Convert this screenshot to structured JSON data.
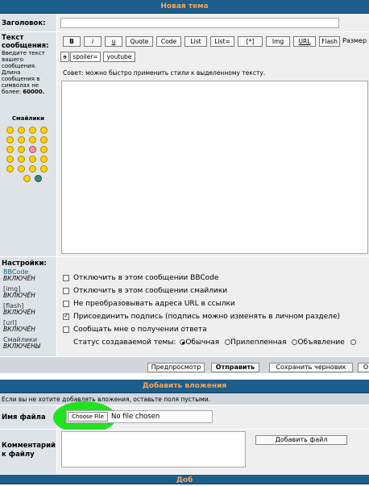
{
  "header": {
    "title": "Новая тема"
  },
  "subject": {
    "label": "Заголовок:",
    "value": ""
  },
  "message": {
    "label": "Текст сообщения:",
    "hint_lines": [
      "Введите текст",
      "вашего",
      "сообщения.",
      "Длина",
      "сообщения в",
      "символах не",
      "более:"
    ],
    "max_length": "60000.",
    "tip": "Совет: можно быстро применить стили к выделенному тексту.",
    "size_label": "Размер",
    "toolbar": [
      "B",
      "i",
      "u",
      "Quote",
      "Code",
      "List",
      "List=",
      "[*]",
      "Img",
      "URL",
      "Flash",
      "s",
      "spoiler=",
      "youtube"
    ]
  },
  "smilies": {
    "title": "Смайлики"
  },
  "settings": {
    "label": "Настройки:",
    "items": [
      {
        "name": "BBCode",
        "state": "ВКЛЮЧЁН"
      },
      {
        "name": "[img]",
        "state": "ВКЛЮЧЁН"
      },
      {
        "name": "[flash]",
        "state": "ВКЛЮЧЁН"
      },
      {
        "name": "[url]",
        "state": "ВКЛЮЧЁН"
      },
      {
        "name": "Смайлики",
        "state": "ВКЛЮЧЕНЫ"
      }
    ]
  },
  "options": [
    {
      "label": "Отключить в этом сообщении BBCode",
      "checked": false
    },
    {
      "label": "Отключить в этом сообщении смайлики",
      "checked": false
    },
    {
      "label": "Не преобразовывать адреса URL в ссылки",
      "checked": false
    },
    {
      "label": "Присоединить подпись (подпись можно изменять в личном разделе)",
      "checked": true
    },
    {
      "label": "Сообщать мне о получении ответа",
      "checked": false
    }
  ],
  "topic_status": {
    "label": "Статус создаваемой темы:",
    "options": [
      "Обычная",
      "Прилепленная",
      "Объявление"
    ],
    "selected": "Обычная"
  },
  "actions": {
    "preview": "Предпросмотр",
    "submit": "Отправить",
    "save_draft": "Сохранить черновик",
    "overflow": "О"
  },
  "attachments": {
    "title": "Добавить вложения",
    "note": "Если вы не хотите добавлять вложения, оставьте поля пустыми.",
    "file_label": "Имя файла",
    "choose_button": "Choose File",
    "no_file": "No file chosen",
    "comment_label": "Комментарий к файлу",
    "add_button": "Добавить файл"
  },
  "footer": {
    "title": "Доб"
  }
}
